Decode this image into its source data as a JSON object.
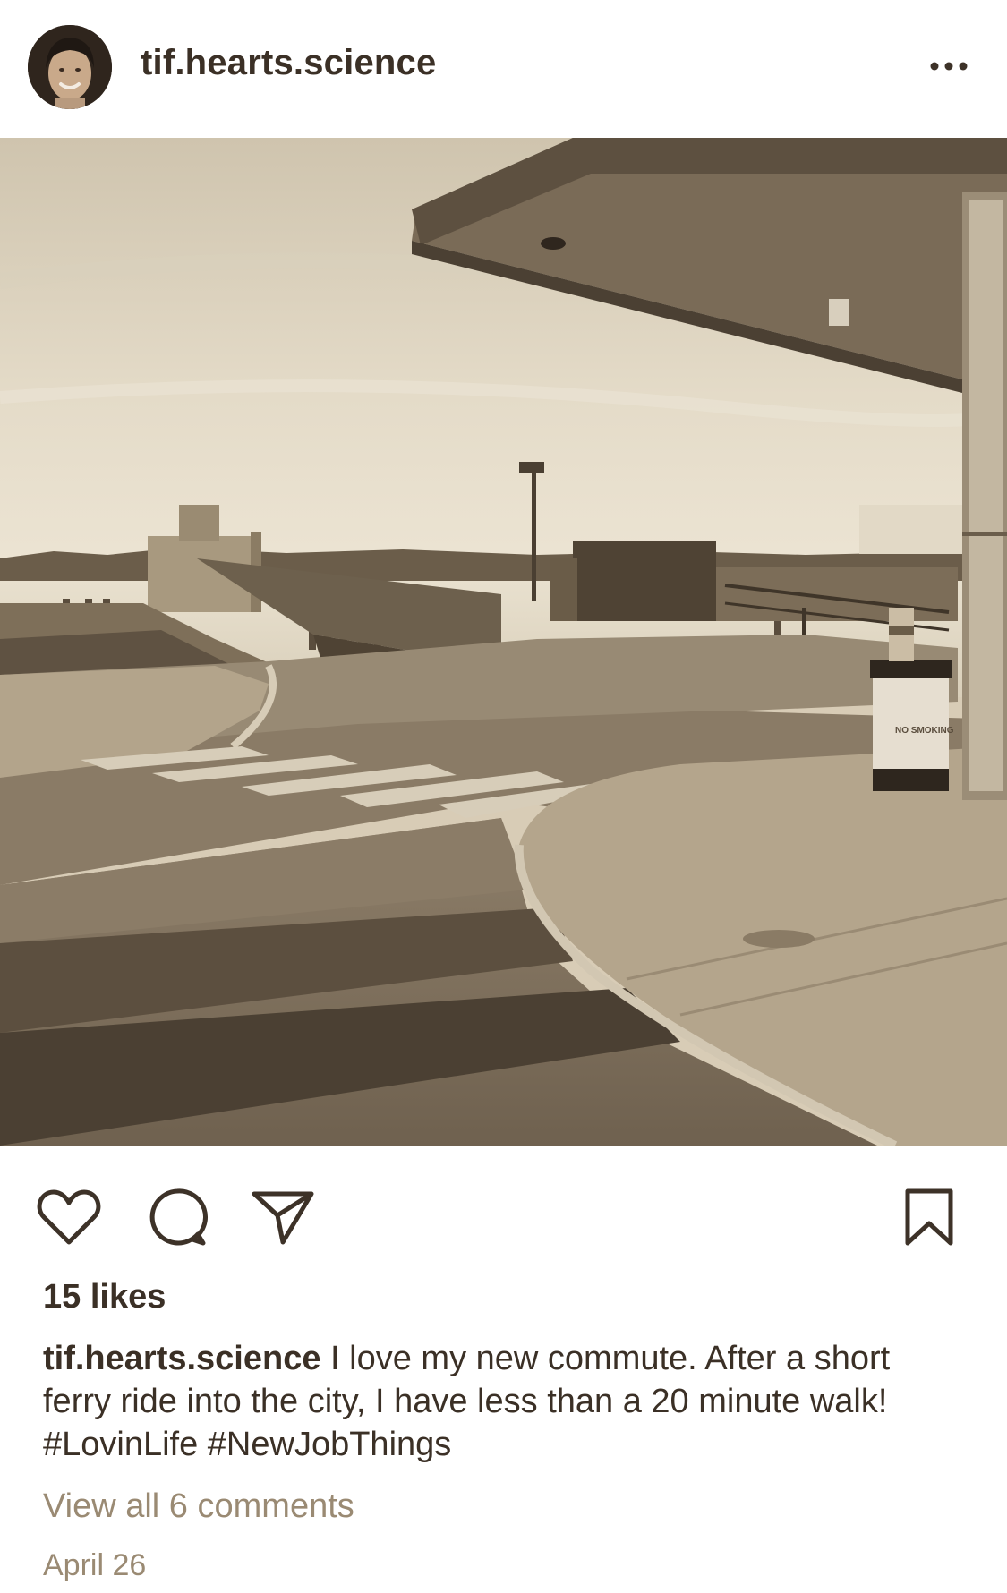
{
  "post": {
    "username": "tif.hearts.science",
    "photo_alt": "Ferry terminal dock at the waterfront",
    "likes_text": "15 likes",
    "caption_user": "tif.hearts.science",
    "caption_text": " I love my new commute. After a short ferry ride into the city, I have less than a 20 minute walk! #LovinLife #NewJobThings",
    "view_comments": "View all 6 comments",
    "date": "April 26",
    "sign_text": "NO SMOKING"
  },
  "icons": {
    "more": "more-options-icon",
    "like": "heart-icon",
    "comment": "comment-icon",
    "share": "share-icon",
    "save": "bookmark-icon"
  },
  "colors": {
    "text": "#3b3026",
    "muted": "#9a8a73",
    "icon": "#3d3228"
  }
}
